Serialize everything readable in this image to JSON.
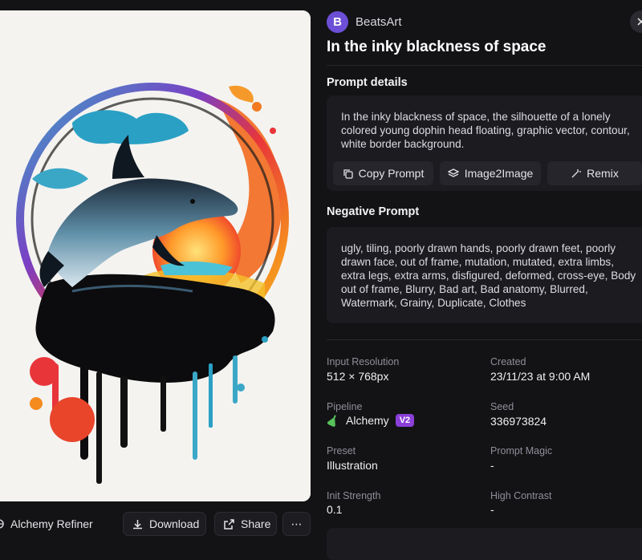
{
  "image": {
    "alt": "dolphin"
  },
  "toolbar": {
    "alchemy_refiner": "Alchemy Refiner",
    "download": "Download",
    "share": "Share",
    "more": "⋯"
  },
  "author": {
    "initial": "B",
    "name": "BeatsArt"
  },
  "title": "In the inky blackness of space",
  "prompt_details": {
    "label": "Prompt details",
    "text": "In the inky blackness of space, the silhouette of a lonely colored young dophin head floating, graphic vector, contour, white border background.",
    "copy_prompt": "Copy Prompt",
    "image2image": "Image2Image",
    "remix": "Remix"
  },
  "negative_prompt": {
    "label": "Negative Prompt",
    "text": "ugly, tiling, poorly drawn hands, poorly drawn feet, poorly drawn face, out of frame, mutation, mutated, extra limbs, extra legs, extra arms, disfigured, deformed, cross-eye, Body out of frame, Blurry, Bad art, Bad anatomy, Blurred, Watermark, Grainy, Duplicate, Clothes"
  },
  "meta": {
    "input_resolution": {
      "label": "Input Resolution",
      "value": "512 × 768px"
    },
    "created": {
      "label": "Created",
      "value": "23/11/23 at 9:00 AM"
    },
    "pipeline": {
      "label": "Pipeline",
      "value": "Alchemy",
      "badge": "V2"
    },
    "seed": {
      "label": "Seed",
      "value": "336973824"
    },
    "preset": {
      "label": "Preset",
      "value": "Illustration"
    },
    "prompt_magic": {
      "label": "Prompt Magic",
      "value": "-"
    },
    "init_strength": {
      "label": "Init Strength",
      "value": "0.1"
    },
    "high_contrast": {
      "label": "High Contrast",
      "value": "-"
    }
  },
  "colors": {
    "accent": "#6c4fd6",
    "badge": "#8b3fd9",
    "background": "#131316",
    "card": "#1b1b20"
  }
}
